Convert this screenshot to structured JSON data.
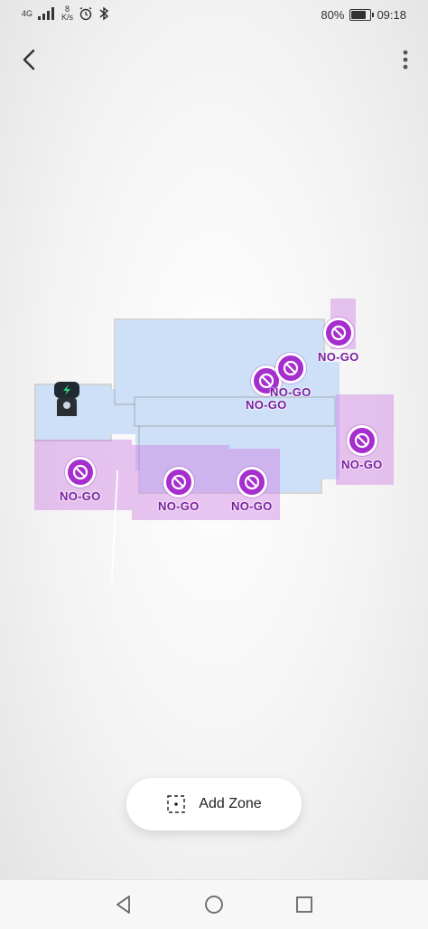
{
  "status_bar": {
    "network_top": "4G",
    "network_bottom": "",
    "speed_value": "8",
    "speed_unit": "K/s",
    "battery_percent": "80%",
    "battery_level": 0.8,
    "time": "09:18",
    "icons": [
      "signal-icon",
      "alarm-icon",
      "bluetooth-icon",
      "battery-icon"
    ]
  },
  "toolbar": {
    "back_icon": "chevron-left-icon",
    "more_icon": "more-vertical-icon"
  },
  "map": {
    "floor_color": "#cde0f8",
    "zone_color": "#cd78e1",
    "icon_color": "#a62ecf",
    "zones": [
      {
        "label": "NO-GO"
      },
      {
        "label": "NO-GO"
      },
      {
        "label": "NO-GO"
      },
      {
        "label": "NO-GO"
      },
      {
        "label": "NO-GO"
      },
      {
        "label": "NO-GO"
      },
      {
        "label": "NO-GO"
      }
    ],
    "dock_icon": "charging-dock-icon"
  },
  "actions": {
    "add_zone_label": "Add Zone",
    "add_zone_icon": "zone-select-icon"
  },
  "nav_bar": {
    "items": [
      "back-triangle-icon",
      "home-circle-icon",
      "recents-square-icon"
    ]
  }
}
